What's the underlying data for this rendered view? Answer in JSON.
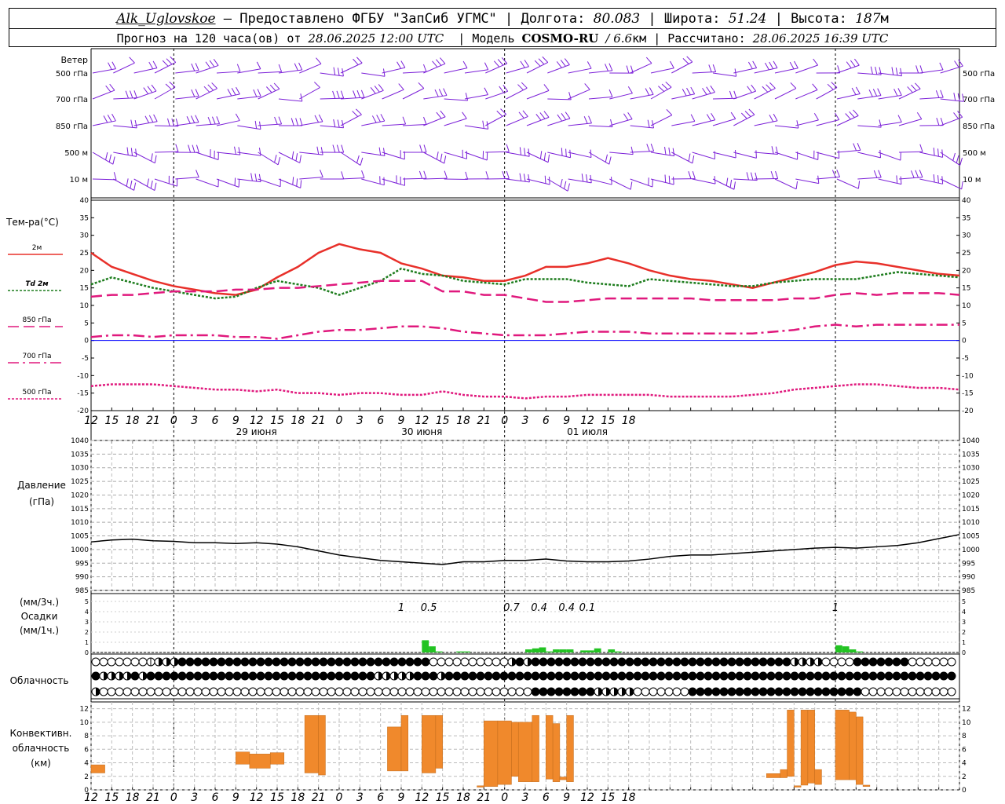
{
  "header": {
    "station": "Alk_Uglovskoe",
    "provider": "— Предоставлено ФГБУ \"ЗапСиб УГМС\" |",
    "lon_label": "Долгота:",
    "lon_value": "80.083",
    "lat_label": "| Широта:",
    "lat_value": "51.24",
    "alt_label": "| Высота:",
    "alt_value": "187",
    "alt_unit": "м",
    "forecast_prefix": "Прогноз на 120 часа(ов) от",
    "forecast_start": "28.06.2025 12:00 UTC",
    "model_label": "| Модель",
    "model_name": "COSMO-RU",
    "model_res": "/ 6.6",
    "model_res_unit": "км",
    "calc_label": "| Рассчитано:",
    "calc_time": "28.06.2025 16:39 UTC"
  },
  "labels": {
    "wind": "Ветер",
    "wind_levels": [
      "500 гПа",
      "700 гПа",
      "850 гПа",
      "500 м",
      "10 м"
    ],
    "temp": "Тем-ра(°C)",
    "temp_legend": [
      "2м",
      "Td 2м",
      "850 гПа",
      "700 гПа",
      "500 гПа"
    ],
    "pressure": "Давление",
    "pressure_unit": "(гПа)",
    "precip_a": "(мм/3ч.)",
    "precip_b": "Осадки",
    "precip_c": "(мм/1ч.)",
    "cloud": "Облачность",
    "conv_a": "Конвективн.",
    "conv_b": "облачность",
    "conv_c": "(км)"
  },
  "colors": {
    "wind": "#7b1fd8",
    "t2m": "#e8302a",
    "td2m": "#1e7d1e",
    "levels": "#e0197d",
    "pressure": "#000000",
    "precip": "#22c322",
    "conv": "#f0892c",
    "zero_line": "#0000ff"
  },
  "chart_data": [
    {
      "type": "line",
      "title": "Тем-ра(°C)",
      "hours_from_start": [
        0,
        3,
        6,
        9,
        12,
        15,
        18,
        21,
        24,
        27,
        30,
        33,
        36,
        39,
        42,
        45,
        48,
        51,
        54,
        57,
        60,
        63,
        66,
        69,
        72,
        75,
        78,
        81,
        84,
        87,
        90,
        93,
        96,
        99,
        102,
        105,
        108,
        111,
        114,
        117,
        120,
        123,
        126
      ],
      "ylim": [
        -20,
        40
      ],
      "series": [
        {
          "name": "2м",
          "values": [
            25,
            21,
            19,
            17,
            15.5,
            14.5,
            13.5,
            13,
            14.5,
            18,
            21,
            25,
            27.5,
            26,
            25,
            22,
            20.5,
            18.5,
            18,
            17,
            17,
            18.5,
            21,
            21,
            22,
            23.5,
            22,
            20,
            18.5,
            17.5,
            17,
            16,
            15,
            16.5,
            18,
            19.5,
            21.5,
            22.5,
            22,
            21,
            20,
            19,
            18.5
          ]
        },
        {
          "name": "Td 2м",
          "values": [
            16,
            18,
            16.5,
            15,
            14,
            13,
            12,
            12.5,
            15,
            17,
            16,
            15,
            13,
            15,
            17,
            20.5,
            19,
            18.5,
            17,
            16.5,
            16,
            17.5,
            17.5,
            17.5,
            16.5,
            16,
            15.5,
            17.5,
            17,
            16.5,
            16,
            15.5,
            15.5,
            16.5,
            17,
            17.5,
            17.5,
            17.5,
            18.5,
            19.5,
            19,
            18.5,
            18
          ]
        },
        {
          "name": "850 гПа",
          "values": [
            12.5,
            13,
            13,
            13.5,
            14,
            14,
            14,
            14.5,
            14.5,
            15,
            15,
            15.5,
            16,
            16.5,
            17,
            17,
            17,
            14,
            14,
            13,
            13,
            12,
            11,
            11,
            11.5,
            12,
            12,
            12,
            12,
            12,
            11.5,
            11.5,
            11.5,
            11.5,
            12,
            12,
            13,
            13.5,
            13,
            13.5,
            13.5,
            13.5,
            13
          ]
        },
        {
          "name": "700 гПа",
          "values": [
            1,
            1.5,
            1.5,
            1,
            1.5,
            1.5,
            1.5,
            1,
            1,
            0.5,
            1.5,
            2.5,
            3,
            3,
            3.5,
            4,
            4,
            3.5,
            2.5,
            2,
            1.5,
            1.5,
            1.5,
            2,
            2.5,
            2.5,
            2.5,
            2,
            2,
            2,
            2,
            2,
            2,
            2.5,
            3,
            4,
            4.5,
            4,
            4.5,
            4.5,
            4.5,
            4.5,
            4.5
          ]
        },
        {
          "name": "500 гПа",
          "values": [
            -13,
            -12.5,
            -12.5,
            -12.5,
            -13,
            -13.5,
            -14,
            -14,
            -14.5,
            -14,
            -15,
            -15,
            -15.5,
            -15,
            -15,
            -15.5,
            -15.5,
            -14.5,
            -15.5,
            -16,
            -16,
            -16.5,
            -16,
            -16,
            -15.5,
            -15.5,
            -15.5,
            -15.5,
            -16,
            -16,
            -16,
            -16,
            -15.5,
            -15,
            -14,
            -13.5,
            -13,
            -12.5,
            -12.5,
            -13,
            -13.5,
            -13.5,
            -14
          ]
        }
      ]
    },
    {
      "type": "line",
      "title": "Давление",
      "ylabel": "(гПа)",
      "ylim": [
        985,
        1040
      ],
      "hours_from_start": [
        0,
        3,
        6,
        9,
        12,
        15,
        18,
        21,
        24,
        27,
        30,
        33,
        36,
        39,
        42,
        45,
        48,
        51,
        54,
        57,
        60,
        63,
        66,
        69,
        72,
        75,
        78,
        81,
        84,
        87,
        90,
        93,
        96,
        99,
        102,
        105,
        108,
        111,
        114,
        117,
        120,
        123,
        126
      ],
      "series": [
        {
          "name": "",
          "values": [
            1002.8,
            1003.5,
            1003.8,
            1003.2,
            1003,
            1002.5,
            1002.5,
            1002.2,
            1002.5,
            1002,
            1001,
            999.5,
            998,
            997,
            996,
            995.5,
            995,
            994.5,
            995.5,
            995.5,
            996,
            996,
            996.5,
            995.8,
            995.5,
            995.5,
            995.8,
            996.5,
            997.5,
            998,
            998,
            998.5,
            999,
            999.5,
            1000,
            1000.5,
            1000.8,
            1000.5,
            1001,
            1001.5,
            1002.5,
            1004,
            1005.5
          ]
        }
      ]
    },
    {
      "type": "bar",
      "title": "Осадки",
      "ylim": [
        0,
        5
      ],
      "hours_from_start": [
        48,
        49,
        50,
        51,
        52,
        53,
        54,
        63,
        64,
        65,
        66,
        67,
        68,
        69,
        70,
        71,
        72,
        73,
        74,
        75,
        76,
        77,
        108,
        109,
        110,
        111
      ],
      "values": [
        1.2,
        0.6,
        0.1,
        0,
        0,
        0.1,
        0.1,
        0.3,
        0.4,
        0.5,
        0.1,
        0.3,
        0.3,
        0.3,
        0,
        0.2,
        0.2,
        0.4,
        0,
        0.3,
        0.1,
        0,
        0.7,
        0.6,
        0.3,
        0.1
      ],
      "annotations": [
        {
          "hour": 45,
          "text": "1"
        },
        {
          "hour": 49,
          "text": "0.5"
        },
        {
          "hour": 61,
          "text": "0.7"
        },
        {
          "hour": 65,
          "text": "0.4"
        },
        {
          "hour": 69,
          "text": "0.4"
        },
        {
          "hour": 72,
          "text": "0.1"
        },
        {
          "hour": 108,
          "text": "1"
        }
      ]
    },
    {
      "type": "table",
      "title": "Облачность",
      "rows": [
        "000000014448888888888888888888888888888888800000000004848888888888888888888888888888888884444000088888880000000",
        "844448488888888888888888888888888888444448884888888888888888888888888888888888888888888888888888888888888888888",
        "400000000000000000000000000000000000000000000000000000008888888844444000000088888888888888888888880000000000004"
      ]
    },
    {
      "type": "bar",
      "title": "Конвективн. облачность",
      "ylabel": "(км)",
      "ylim": [
        0,
        13
      ],
      "bars": [
        {
          "h0": 0,
          "h1": 2,
          "bottom": 2.5,
          "top": 3.7
        },
        {
          "h0": 21,
          "h1": 23,
          "bottom": 3.8,
          "top": 5.6
        },
        {
          "h0": 23,
          "h1": 26,
          "bottom": 3.2,
          "top": 5.3
        },
        {
          "h0": 26,
          "h1": 28,
          "bottom": 3.8,
          "top": 5.5
        },
        {
          "h0": 31,
          "h1": 33,
          "bottom": 2.5,
          "top": 11.0
        },
        {
          "h0": 33,
          "h1": 34,
          "bottom": 2.2,
          "top": 11.0
        },
        {
          "h0": 43,
          "h1": 45,
          "bottom": 2.8,
          "top": 9.3
        },
        {
          "h0": 45,
          "h1": 46,
          "bottom": 2.8,
          "top": 11.0
        },
        {
          "h0": 48,
          "h1": 50,
          "bottom": 2.5,
          "top": 11.0
        },
        {
          "h0": 50,
          "h1": 51,
          "bottom": 3.2,
          "top": 11.0
        },
        {
          "h0": 56,
          "h1": 57,
          "bottom": 0.4,
          "top": 0.6
        },
        {
          "h0": 57,
          "h1": 59,
          "bottom": 0.5,
          "top": 10.2
        },
        {
          "h0": 59,
          "h1": 61,
          "bottom": 0.8,
          "top": 10.2
        },
        {
          "h0": 61,
          "h1": 62,
          "bottom": 2.0,
          "top": 10.0
        },
        {
          "h0": 62,
          "h1": 64,
          "bottom": 1.2,
          "top": 10.0
        },
        {
          "h0": 64,
          "h1": 65,
          "bottom": 1.2,
          "top": 11.0
        },
        {
          "h0": 66,
          "h1": 67,
          "bottom": 1.6,
          "top": 11.0
        },
        {
          "h0": 67,
          "h1": 68,
          "bottom": 1.2,
          "top": 9.8
        },
        {
          "h0": 68,
          "h1": 69,
          "bottom": 1.5,
          "top": 1.9
        },
        {
          "h0": 69,
          "h1": 70,
          "bottom": 1.2,
          "top": 11.0
        },
        {
          "h0": 98,
          "h1": 100,
          "bottom": 1.8,
          "top": 2.4
        },
        {
          "h0": 100,
          "h1": 101,
          "bottom": 1.8,
          "top": 3.0
        },
        {
          "h0": 101,
          "h1": 102,
          "bottom": 2.0,
          "top": 11.8
        },
        {
          "h0": 102,
          "h1": 103,
          "bottom": 0.4,
          "top": 0.6
        },
        {
          "h0": 103,
          "h1": 104,
          "bottom": 0.7,
          "top": 11.8
        },
        {
          "h0": 104,
          "h1": 105,
          "bottom": 1.0,
          "top": 11.8
        },
        {
          "h0": 105,
          "h1": 106,
          "bottom": 0.8,
          "top": 3.0
        },
        {
          "h0": 108,
          "h1": 110,
          "bottom": 1.5,
          "top": 11.8
        },
        {
          "h0": 110,
          "h1": 111,
          "bottom": 1.5,
          "top": 11.5
        },
        {
          "h0": 111,
          "h1": 112,
          "bottom": 0.8,
          "top": 10.8
        },
        {
          "h0": 112,
          "h1": 113,
          "bottom": 0.5,
          "top": 0.7
        }
      ]
    }
  ],
  "axis": {
    "tick_labels": [
      "12",
      "15",
      "18",
      "21",
      "0",
      "3",
      "6",
      "9",
      "12",
      "15",
      "18",
      "21",
      "0",
      "3",
      "6",
      "9",
      "12",
      "15",
      "18",
      "21",
      "0",
      "3",
      "6",
      "9",
      "12",
      "15",
      "18"
    ],
    "day_labels": [
      {
        "hour": 24,
        "text": "29 июня"
      },
      {
        "hour": 48,
        "text": "30 июня"
      },
      {
        "hour": 72,
        "text": "01 июля"
      }
    ],
    "temp_ticks": [
      "40",
      "35",
      "30",
      "25",
      "20",
      "15",
      "10",
      "5",
      "0",
      "-5",
      "-10",
      "-15",
      "-20"
    ],
    "pressure_ticks": [
      "1040",
      "1035",
      "1030",
      "1025",
      "1020",
      "1015",
      "1010",
      "1005",
      "1000",
      "995",
      "990",
      "985"
    ],
    "precip_ticks": [
      "5",
      "4",
      "3",
      "2",
      "1",
      "0"
    ],
    "conv_ticks": [
      "12",
      "10",
      "8",
      "6",
      "4",
      "2",
      "0"
    ]
  }
}
